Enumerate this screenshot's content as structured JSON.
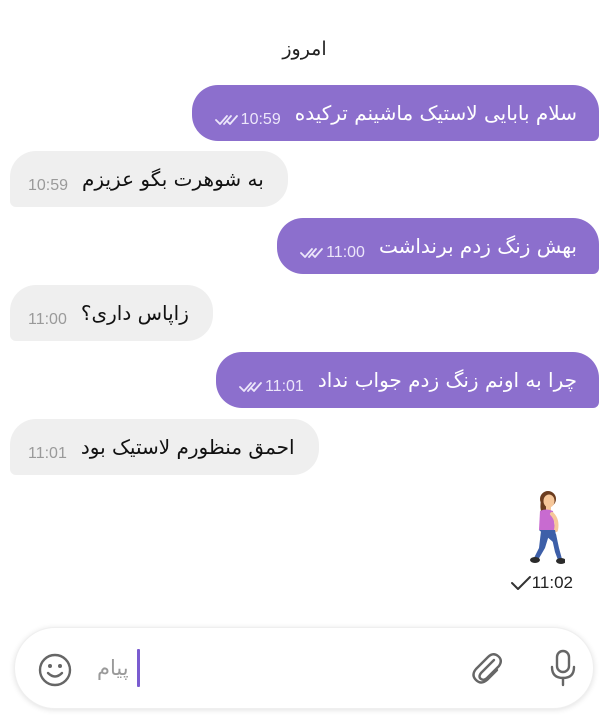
{
  "date_separator": "امروز",
  "messages": [
    {
      "text": "سلام بابایی لاستیک ماشینم ترکیده",
      "time": "10:59"
    },
    {
      "text": "به شوهرت بگو عزیزم",
      "time": "10:59"
    },
    {
      "text": "بهش زنگ زدم برنداشت",
      "time": "11:00"
    },
    {
      "text": "زاپاس داری؟",
      "time": "11:00"
    },
    {
      "text": "چرا به اونم زنگ زدم جواب نداد",
      "time": "11:01"
    },
    {
      "text": "احمق منظورم لاستیک بود",
      "time": "11:01"
    }
  ],
  "emoji_message": {
    "icon": "woman-walking-emoji",
    "time": "11:02"
  },
  "composer": {
    "placeholder": "پیام",
    "icons": [
      "smiley-icon",
      "paperclip-icon",
      "microphone-icon"
    ]
  },
  "colors": {
    "outgoing_bubble": "#8c6fcd",
    "incoming_bubble": "#efefef",
    "accent": "#7a5cd0"
  }
}
